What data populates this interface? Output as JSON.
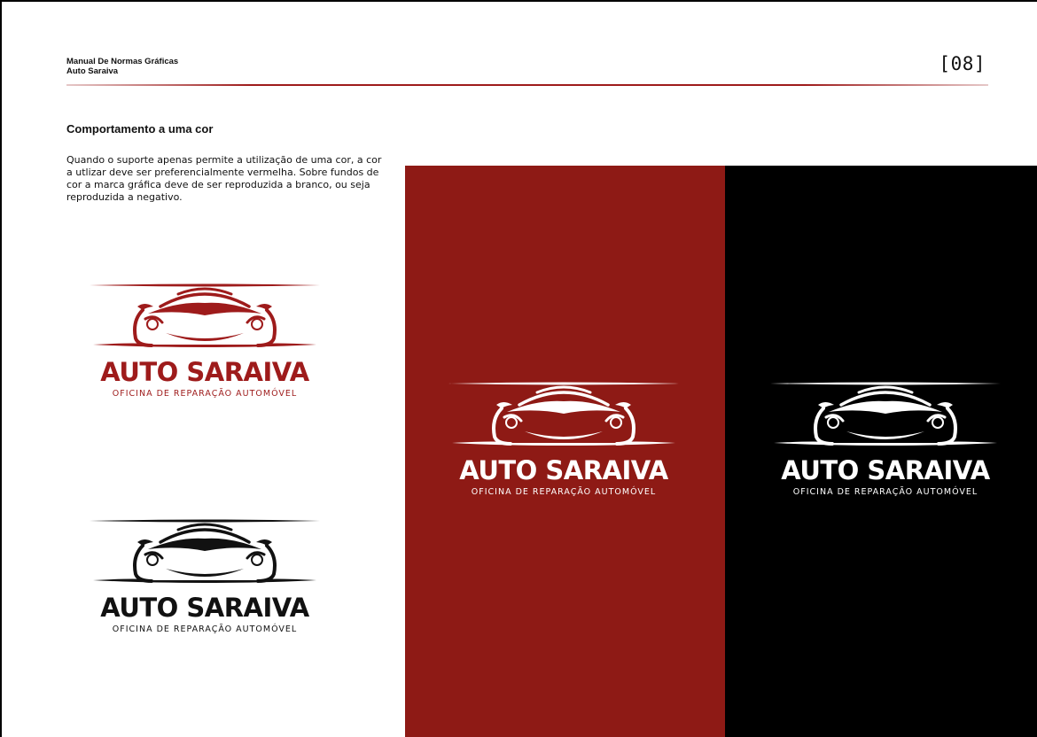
{
  "header": {
    "doc_title_line1": "Manual De Normas Gráficas",
    "doc_title_line2": "Auto Saraiva",
    "page_number": "[08]",
    "accent_color": "#9e1b1b"
  },
  "section": {
    "heading": "Comportamento a uma cor",
    "body": "Quando o suporte apenas permite a utilização de uma cor, a cor a utlizar deve ser preferencialmente vermelha. Sobre fundos de cor a marca gráfica deve de ser reproduzida a branco, ou seja reproduzida a negativo."
  },
  "logo": {
    "name": "AUTO SARAIVA",
    "tagline": "OFICINA DE REPARAÇÃO AUTOMÓVEL",
    "icon": "sports-car-front-icon"
  },
  "variants": [
    {
      "label": "red",
      "color": "#9e1b1b",
      "background": "#ffffff"
    },
    {
      "label": "black",
      "color": "#111111",
      "background": "#ffffff"
    },
    {
      "label": "white-on-red",
      "color": "#ffffff",
      "background": "#8e1a15"
    },
    {
      "label": "white-on-black",
      "color": "#ffffff",
      "background": "#000000"
    }
  ]
}
